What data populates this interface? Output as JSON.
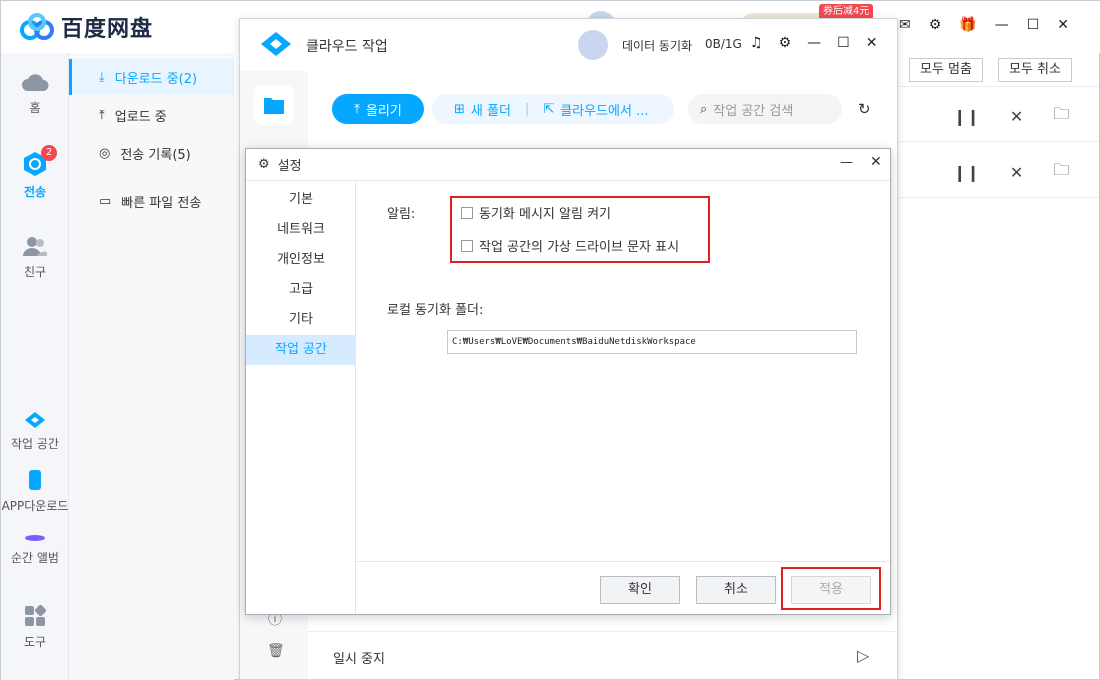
{
  "app": {
    "brand": "百度网盘",
    "promo": "券后减4元"
  },
  "leftnav": [
    {
      "label": "홈"
    },
    {
      "label": "전송",
      "badge": "2"
    },
    {
      "label": "친구"
    },
    {
      "label": "작업 공간"
    },
    {
      "label": "APP다운로드"
    },
    {
      "label": "순간 앨범"
    },
    {
      "label": "도구"
    }
  ],
  "sidebar": [
    {
      "label": "다운로드 중(2)"
    },
    {
      "label": "업로드 중"
    },
    {
      "label": "전송 기록(5)"
    },
    {
      "label": "빠른 파일 전송"
    }
  ],
  "toolbar": {
    "pause_all": "모두 멈춤",
    "cancel_all": "모두 취소"
  },
  "cloud": {
    "title": "클라우드 작업",
    "sync_label": "데이터 동기화",
    "sync_size": "0B/1G",
    "upload_btn": "올리기",
    "new_folder_btn": "새 폴더",
    "from_cloud_btn": "클라우드에서 ...",
    "search_placeholder": "작업 공간 검색",
    "paused_label": "일시 중지"
  },
  "settings": {
    "title": "설정",
    "nav": [
      {
        "label": "기본"
      },
      {
        "label": "네트워크"
      },
      {
        "label": "개인정보"
      },
      {
        "label": "고급"
      },
      {
        "label": "기타"
      },
      {
        "label": "작업 공간"
      }
    ],
    "alert_label": "알림:",
    "opt1": "동기화 메시지 알림 켜기",
    "opt2": "작업 공간의 가상 드라이브 문자 표시",
    "local_folder_label": "로컬 동기화 폴더:",
    "folder_path": "C:₩Users₩LoVE₩Documents₩BaiduNetdiskWorkspace",
    "ok": "확인",
    "cancel": "취소",
    "apply": "적용"
  },
  "colors": {
    "accent": "#06a7ff",
    "highlight": "#e02020",
    "badge": "#f2484e"
  }
}
